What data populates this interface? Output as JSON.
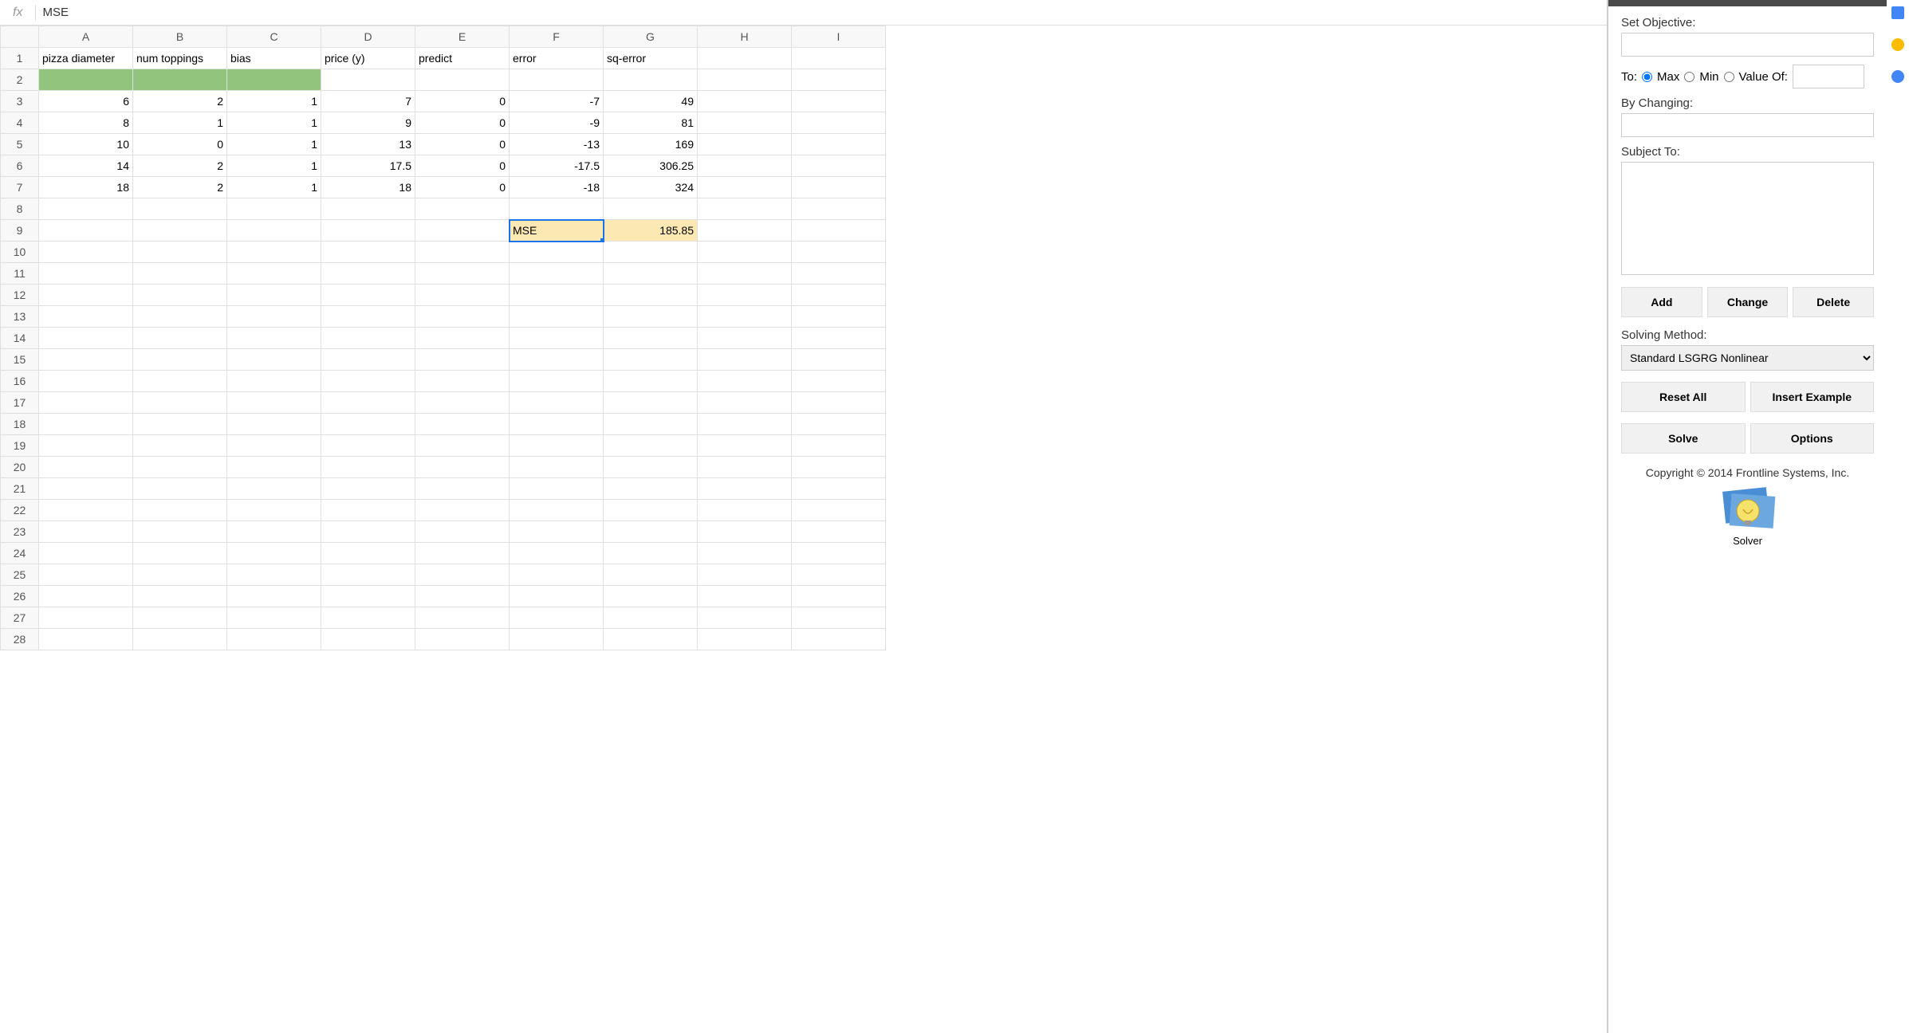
{
  "formula_bar": {
    "fx": "fx",
    "value": "MSE"
  },
  "columns": [
    "A",
    "B",
    "C",
    "D",
    "E",
    "F",
    "G",
    "H",
    "I"
  ],
  "row_count": 28,
  "headers_row": [
    "pizza diameter",
    "num toppings",
    "bias",
    "price (y)",
    "predict",
    "error",
    "sq-error",
    ""
  ],
  "data_rows": [
    {
      "A": "6",
      "B": "2",
      "C": "1",
      "D": "7",
      "E": "0",
      "F": "-7",
      "G": "49"
    },
    {
      "A": "8",
      "B": "1",
      "C": "1",
      "D": "9",
      "E": "0",
      "F": "-9",
      "G": "81"
    },
    {
      "A": "10",
      "B": "0",
      "C": "1",
      "D": "13",
      "E": "0",
      "F": "-13",
      "G": "169"
    },
    {
      "A": "14",
      "B": "2",
      "C": "1",
      "D": "17.5",
      "E": "0",
      "F": "-17.5",
      "G": "306.25"
    },
    {
      "A": "18",
      "B": "2",
      "C": "1",
      "D": "18",
      "E": "0",
      "F": "-18",
      "G": "324"
    }
  ],
  "mse_row": {
    "label": "MSE",
    "value": "185.85"
  },
  "solver": {
    "set_objective_label": "Set Objective:",
    "to_label": "To:",
    "max_label": "Max",
    "min_label": "Min",
    "value_of_label": "Value Of:",
    "by_changing_label": "By Changing:",
    "subject_to_label": "Subject To:",
    "add_btn": "Add",
    "change_btn": "Change",
    "delete_btn": "Delete",
    "solving_method_label": "Solving Method:",
    "solving_method_value": "Standard LSGRG Nonlinear",
    "reset_btn": "Reset All",
    "insert_example_btn": "Insert Example",
    "solve_btn": "Solve",
    "options_btn": "Options",
    "copyright": "Copyright © 2014 Frontline Systems, Inc.",
    "logo_label": "Solver"
  }
}
